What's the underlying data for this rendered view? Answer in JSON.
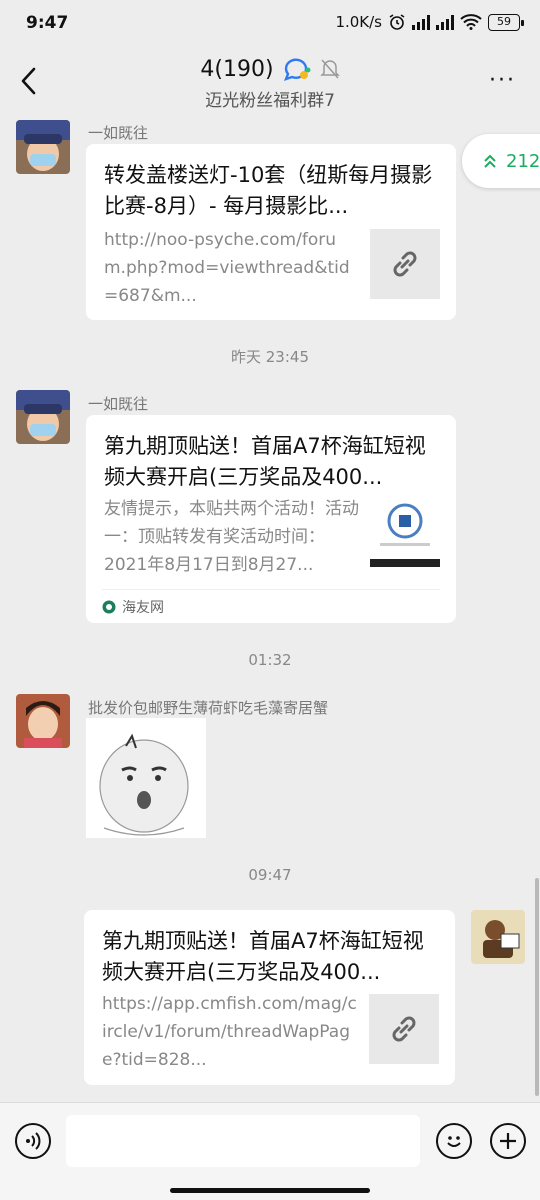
{
  "status_bar": {
    "time": "9:47",
    "speed": "1.0K/s",
    "battery": "59"
  },
  "header": {
    "back_label": "<",
    "title": "4(190)",
    "subtitle": "迈光粉丝福利群7",
    "more_label": "···"
  },
  "floating_badge": {
    "count": "212"
  },
  "messages": [
    {
      "sender": "一如既往",
      "title": "转发盖楼送灯-10套（纽斯每月摄影比赛-8月）- 每月摄影比...",
      "desc": "http://noo-psyche.com/forum.php?mod=viewthread&tid=687&m..."
    },
    {
      "timestamp": "昨天 23:45"
    },
    {
      "sender": "一如既往",
      "title": "第九期顶贴送！首届A7杯海缸短视频大赛开启(三万奖品及400...",
      "desc": "友情提示，本贴共两个活动！活动一：顶贴转发有奖活动时间：2021年8月17日到8月27...",
      "source": "海友网"
    },
    {
      "timestamp": "01:32"
    },
    {
      "sender": "批发价包邮野生薄荷虾吃毛藻寄居蟹"
    },
    {
      "timestamp": "09:47"
    },
    {
      "title": "第九期顶贴送！首届A7杯海缸短视频大赛开启(三万奖品及400...",
      "desc": "https://app.cmfish.com/mag/circle/v1/forum/threadWapPage?tid=828..."
    }
  ],
  "colors": {
    "background": "#ededed",
    "badge_green": "#1aad5f"
  }
}
